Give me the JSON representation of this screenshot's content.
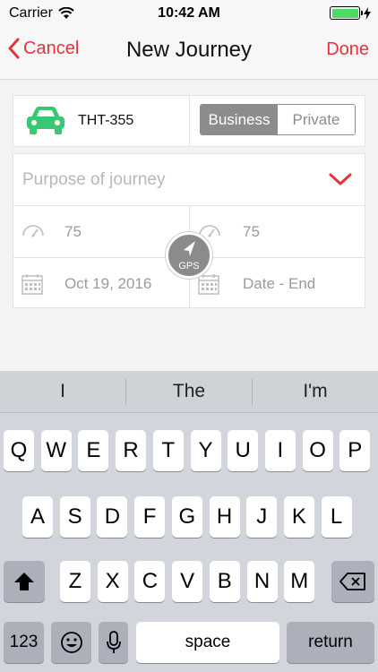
{
  "status_bar": {
    "carrier": "Carrier",
    "time": "10:42 AM"
  },
  "nav": {
    "cancel": "Cancel",
    "title": "New Journey",
    "done": "Done"
  },
  "vehicle": {
    "plate": "THT-355",
    "type_options": [
      "Business",
      "Private"
    ],
    "selected_type": "Business"
  },
  "form": {
    "purpose_placeholder": "Purpose of journey",
    "odometer_start": "75",
    "odometer_end": "75",
    "date_start": "Oct 19, 2016",
    "date_end_placeholder": "Date - End",
    "gps_label": "GPS"
  },
  "colors": {
    "accent": "#e5333a",
    "car": "#38c773",
    "segment": "#8c8c8c"
  },
  "keyboard": {
    "suggestions": [
      "I",
      "The",
      "I'm"
    ],
    "row1": [
      "Q",
      "W",
      "E",
      "R",
      "T",
      "Y",
      "U",
      "I",
      "O",
      "P"
    ],
    "row2": [
      "A",
      "S",
      "D",
      "F",
      "G",
      "H",
      "J",
      "K",
      "L"
    ],
    "row3": [
      "Z",
      "X",
      "C",
      "V",
      "B",
      "N",
      "M"
    ],
    "numbers_label": "123",
    "space_label": "space",
    "return_label": "return",
    "icons": [
      "shift-icon",
      "backspace-icon",
      "emoji-icon",
      "microphone-icon"
    ]
  }
}
